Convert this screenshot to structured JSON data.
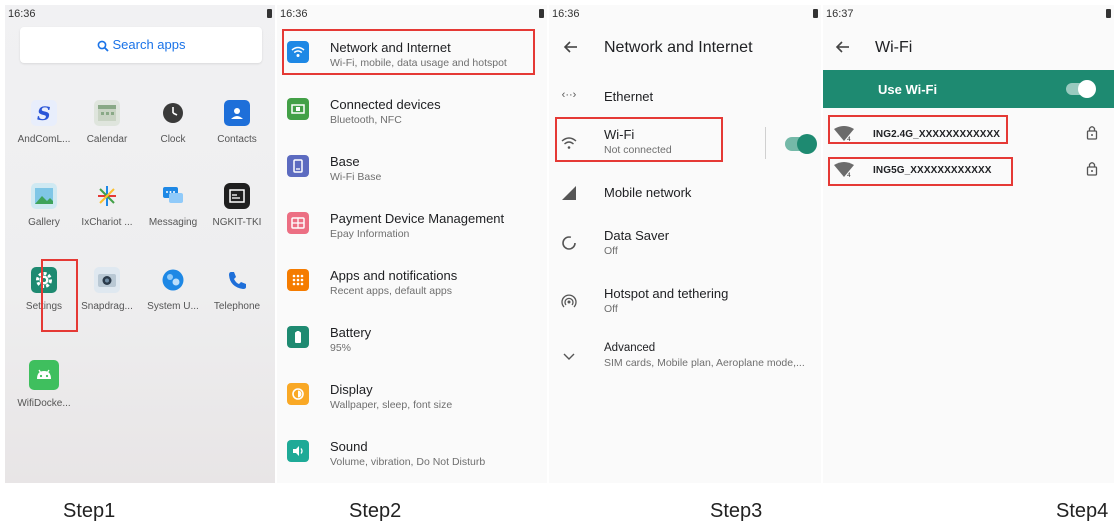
{
  "steps": [
    "Step1",
    "Step2",
    "Step3",
    "Step4"
  ],
  "panel1": {
    "time": "16:36",
    "search_label": "Search apps",
    "apps": [
      {
        "label": "AndComL..."
      },
      {
        "label": "Calendar"
      },
      {
        "label": "Clock"
      },
      {
        "label": "Contacts"
      },
      {
        "label": "Gallery"
      },
      {
        "label": "IxChariot ..."
      },
      {
        "label": "Messaging"
      },
      {
        "label": "NGKIT-TKI"
      },
      {
        "label": "Settings"
      },
      {
        "label": "Snapdrag..."
      },
      {
        "label": "System U..."
      },
      {
        "label": "Telephone"
      },
      {
        "label": "WifiDocke..."
      }
    ]
  },
  "panel2": {
    "time": "16:36",
    "items": [
      {
        "title": "Network and Internet",
        "subtitle": "Wi-Fi, mobile, data usage and hotspot",
        "color": "#1e88e5"
      },
      {
        "title": "Connected devices",
        "subtitle": "Bluetooth, NFC",
        "color": "#43a047"
      },
      {
        "title": "Base",
        "subtitle": "Wi-Fi Base",
        "color": "#5c6bc0"
      },
      {
        "title": "Payment Device Management",
        "subtitle": "Epay Information",
        "color": "#ec6f83"
      },
      {
        "title": "Apps and notifications",
        "subtitle": "Recent apps, default apps",
        "color": "#f57c00"
      },
      {
        "title": "Battery",
        "subtitle": "95%",
        "color": "#1e8a71"
      },
      {
        "title": "Display",
        "subtitle": "Wallpaper, sleep, font size",
        "color": "#f9a825"
      },
      {
        "title": "Sound",
        "subtitle": "Volume, vibration, Do Not Disturb",
        "color": "#1eaa97"
      }
    ]
  },
  "panel3": {
    "time": "16:36",
    "title": "Network and Internet",
    "items": [
      {
        "title": "Ethernet",
        "subtitle": ""
      },
      {
        "title": "Wi-Fi",
        "subtitle": "Not connected"
      },
      {
        "title": "Mobile network",
        "subtitle": ""
      },
      {
        "title": "Data Saver",
        "subtitle": "Off"
      },
      {
        "title": "Hotspot and tethering",
        "subtitle": "Off"
      },
      {
        "title": "Advanced",
        "subtitle": "SIM cards, Mobile plan, Aeroplane mode,..."
      }
    ],
    "accent": "#1e8a71"
  },
  "panel4": {
    "time": "16:37",
    "title": "Wi-Fi",
    "use_wifi_label": "Use Wi-Fi",
    "networks": [
      {
        "ssid": "ING2.4G_XXXXXXXXXXXX"
      },
      {
        "ssid": "ING5G_XXXXXXXXXXXX"
      }
    ],
    "accent": "#1e8a71"
  }
}
